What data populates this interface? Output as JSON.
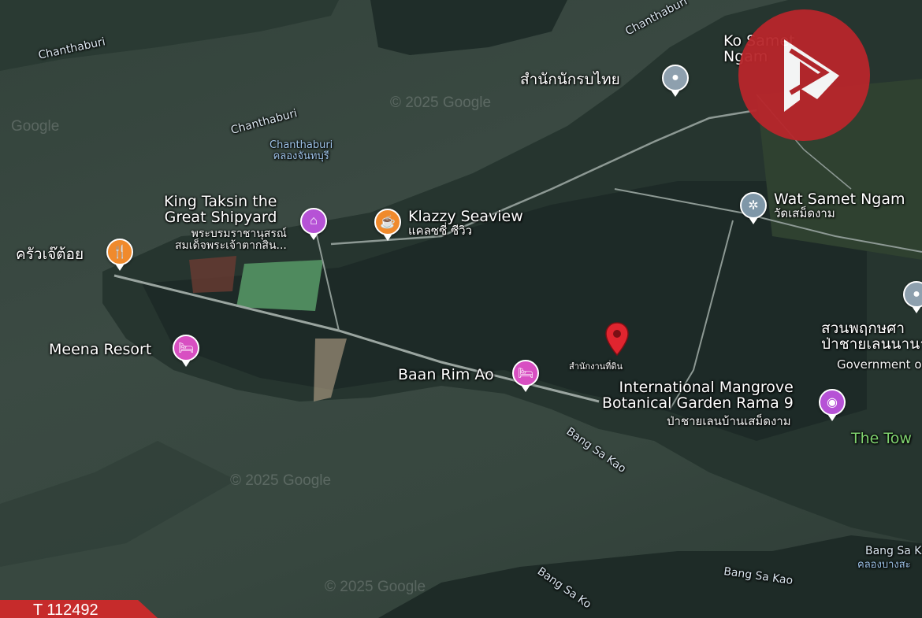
{
  "places": {
    "chanthaburi_1": "Chanthaburi",
    "chanthaburi_2": "Chanthaburi",
    "chanthaburi_3": "Chanthaburi",
    "chanthaburi_river_en": "Chanthaburi",
    "chanthaburi_river_th": "คลองจันทบุรี",
    "office_th": "สำนักนักรบไทย",
    "ko_samet": "Ko Samet\nNgam",
    "king_taksin_1": "King Taksin the",
    "king_taksin_2": "Great Shipyard",
    "king_taksin_th1": "พระบรมราชานุสรณ์",
    "king_taksin_th2": "สมเด็จพระเจ้าตากสิน...",
    "klazzy_en": "Klazzy Seaview",
    "klazzy_th": "แคลซซี่ ซีวิว",
    "kitchen_th": "ครัวเจ๊ต้อย",
    "meena": "Meena Resort",
    "baan_rim_ao": "Baan Rim Ao",
    "wat_samet_en": "Wat Samet Ngam",
    "wat_samet_th": "วัดเสม็ดงาม",
    "park_th1": "สวนพฤกษศา",
    "park_th2": "ป่าชายเลนนานาชาติ",
    "government": "Government o",
    "mangrove_1": "International Mangrove",
    "mangrove_2": "Botanical Garden Rama 9",
    "mangrove_th": "ป่าชายเลนบ้านเสม็ดงาม",
    "the_tow": "The Tow",
    "land_office_th": "สำนักงานที่ดิน",
    "bang_sa_kao_1": "Bang Sa Kao",
    "bang_sa_kao_2": "Bang Sa Kao",
    "bang_sa_kao_3": "Bang Sa Ko",
    "bang_sa_kao_4": "Bang Sa K",
    "bang_sa_kao_th": "คลองบางสะ"
  },
  "watermarks": {
    "w1": "© 2025 Google",
    "w2": "© 2025 Google",
    "w3": "© 2025 Google",
    "w4": "Google"
  },
  "listing_code": "T 112492",
  "colors": {
    "logo": "#b8262b",
    "pin_red": "#e0252f",
    "food_pin": "#f08a2c",
    "attraction_pin": "#b652d6",
    "hotel_pin": "#d84fc2"
  },
  "icons": {
    "restaurant": "fork-knife-icon",
    "cafe": "cup-icon",
    "museum": "landmark-icon",
    "hotel": "bed-icon",
    "camera": "camera-icon",
    "temple": "temple-icon",
    "place": "place-icon"
  }
}
